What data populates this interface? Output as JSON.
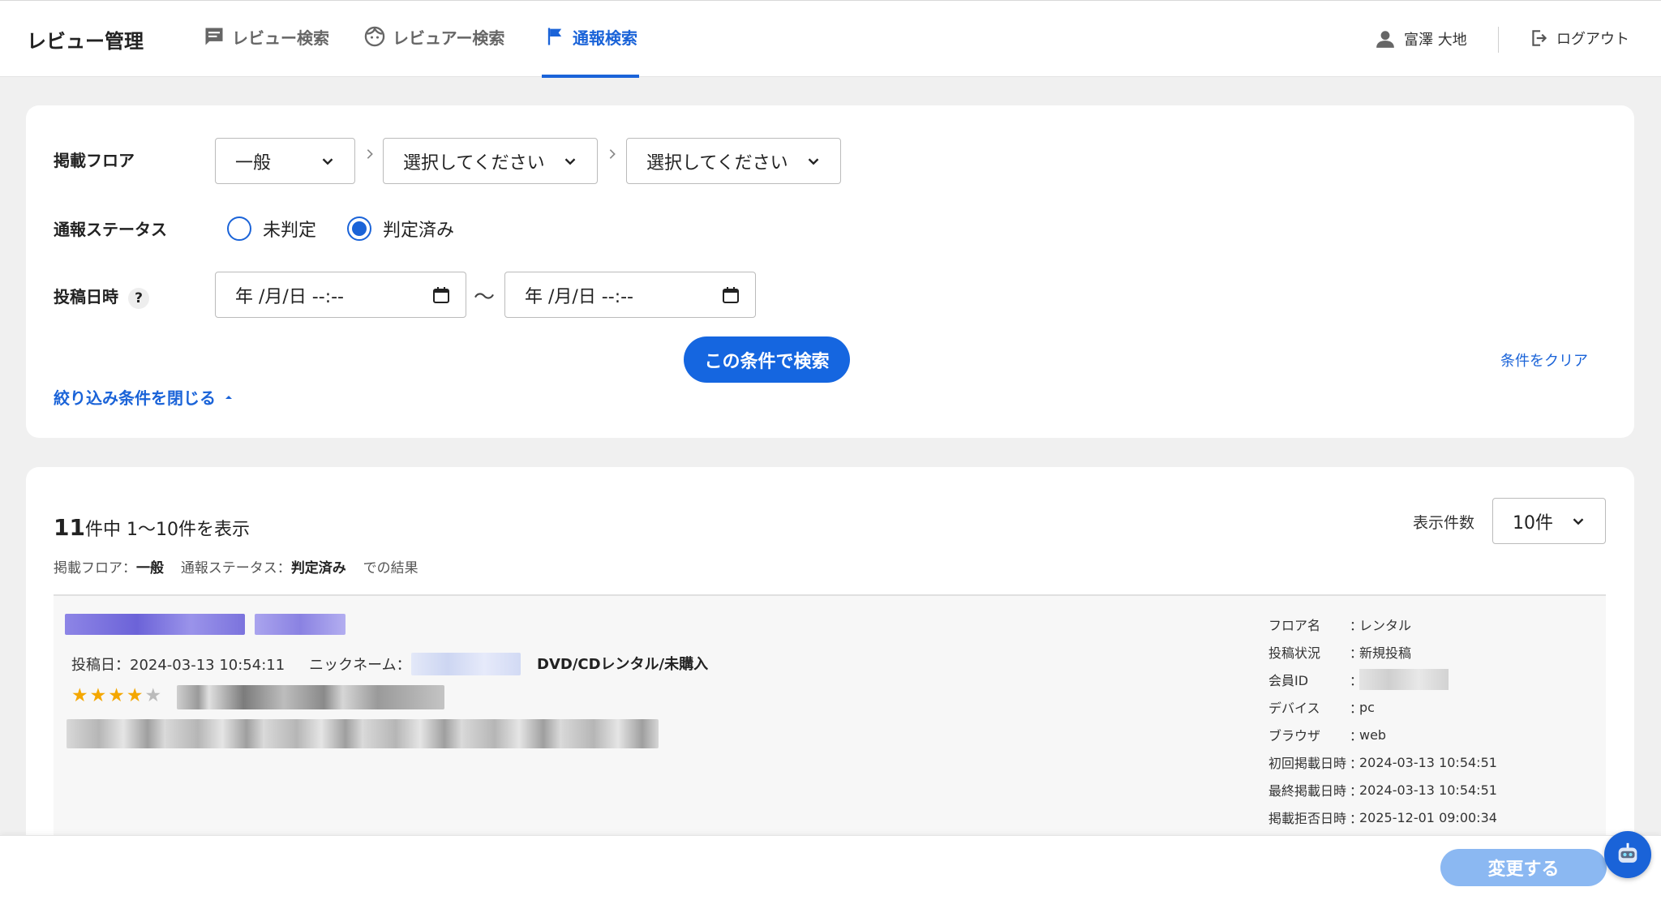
{
  "header": {
    "app_title": "レビュー管理",
    "tabs": [
      {
        "label": "レビュー検索",
        "icon": "comment-icon"
      },
      {
        "label": "レビュアー検索",
        "icon": "face-icon"
      },
      {
        "label": "通報検索",
        "icon": "flag-icon",
        "active": true
      }
    ],
    "user_name": "富澤 大地",
    "logout_label": "ログアウト"
  },
  "search": {
    "floor_label": "掲載フロア",
    "floor_select": "一般",
    "floor_sub1": "選択してください",
    "floor_sub2": "選択してください",
    "status_label": "通報ステータス",
    "status_options": [
      {
        "label": "未判定",
        "selected": false
      },
      {
        "label": "判定済み",
        "selected": true
      }
    ],
    "date_label": "投稿日時",
    "help_mark": "?",
    "date_from_placeholder": "年 /月/日 --:--",
    "date_to_placeholder": "年 /月/日 --:--",
    "tilde": "〜",
    "search_button": "この条件で検索",
    "clear_link": "条件をクリア",
    "collapse_link": "絞り込み条件を閉じる"
  },
  "results": {
    "total": "11",
    "count_suffix": "件中 1〜10件を表示",
    "cond_floor_key": "掲載フロア：",
    "cond_floor_val": "一般",
    "cond_status_key": "通報ステータス：",
    "cond_status_val": "判定済み",
    "cond_suffix": "での結果",
    "per_page_label": "表示件数",
    "per_page_value": "10件",
    "item": {
      "posted": "投稿日：2024-03-13 10:54:11",
      "nickname_label": "ニックネーム：",
      "type": "DVD/CDレンタル/未購入",
      "rating": 4,
      "star_max": 5,
      "info": [
        {
          "key": "フロア名",
          "value": "レンタル"
        },
        {
          "key": "投稿状況",
          "value": "新規投稿"
        },
        {
          "key": "会員ID",
          "value": ""
        },
        {
          "key": "デバイス",
          "value": "pc"
        },
        {
          "key": "ブラウザ",
          "value": "web"
        },
        {
          "key": "初回掲載日時",
          "value": "2024-03-13 10:54:51"
        },
        {
          "key": "最終掲載日時",
          "value": "2024-03-13 10:54:51"
        },
        {
          "key": "掲載拒否日時",
          "value": "2025-12-01 09:00:34"
        }
      ]
    }
  },
  "footer": {
    "change_button": "変更する"
  },
  "colors": {
    "accent": "#1a63d8",
    "star": "#f4a700",
    "disabled_button": "#8bb8f2"
  }
}
